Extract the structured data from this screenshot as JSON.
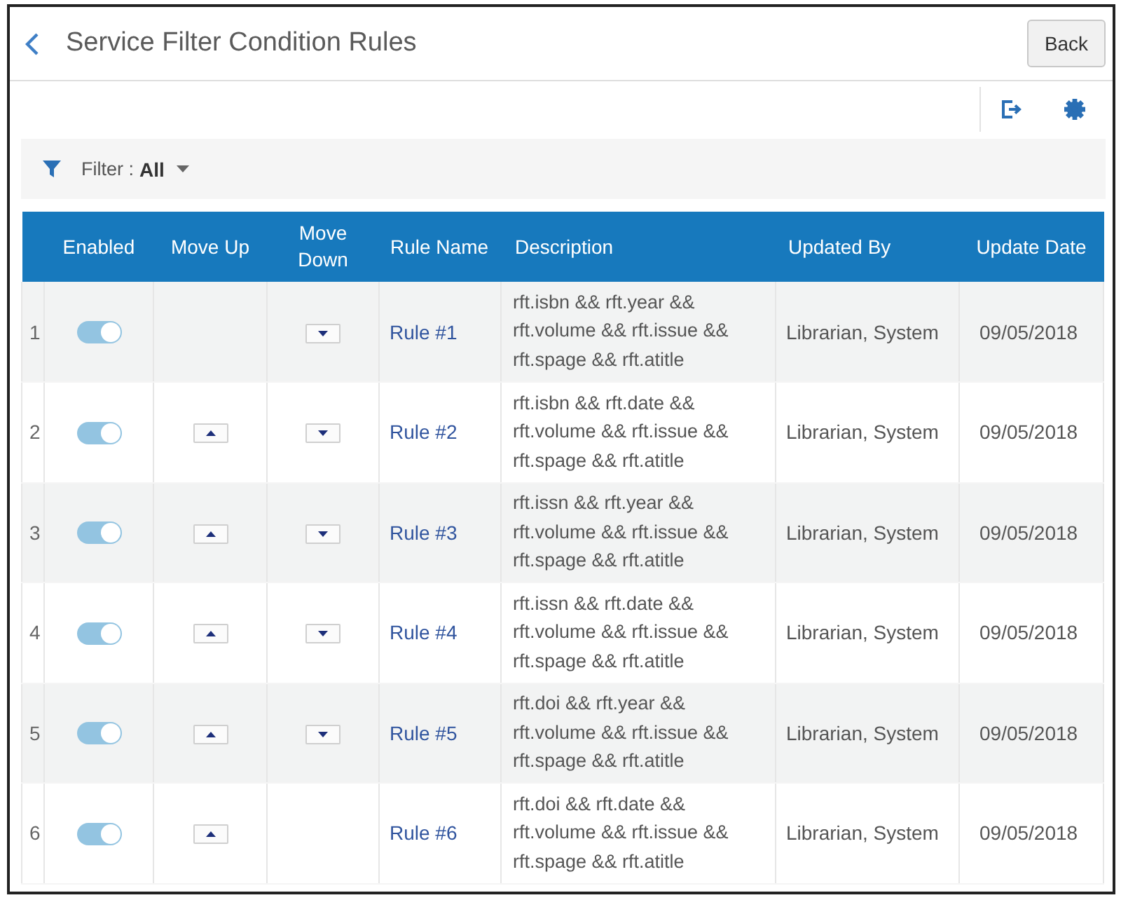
{
  "header": {
    "title": "Service Filter Condition Rules",
    "back_button": "Back"
  },
  "filter": {
    "label": "Filter :",
    "value": "All"
  },
  "table": {
    "columns": [
      "Enabled",
      "Move Up",
      "Move Down",
      "Rule Name",
      "Description",
      "Updated By",
      "Update Date"
    ],
    "rows": [
      {
        "number": "1",
        "enabled": true,
        "can_move_up": false,
        "can_move_down": true,
        "rule_name": "Rule #1",
        "description": "rft.isbn && rft.year && rft.volume && rft.issue && rft.spage && rft.atitle",
        "updated_by": "Librarian, System",
        "update_date": "09/05/2018"
      },
      {
        "number": "2",
        "enabled": true,
        "can_move_up": true,
        "can_move_down": true,
        "rule_name": "Rule #2",
        "description": "rft.isbn && rft.date && rft.volume && rft.issue && rft.spage && rft.atitle",
        "updated_by": "Librarian, System",
        "update_date": "09/05/2018"
      },
      {
        "number": "3",
        "enabled": true,
        "can_move_up": true,
        "can_move_down": true,
        "rule_name": "Rule #3",
        "description": "rft.issn && rft.year && rft.volume && rft.issue && rft.spage && rft.atitle",
        "updated_by": "Librarian, System",
        "update_date": "09/05/2018"
      },
      {
        "number": "4",
        "enabled": true,
        "can_move_up": true,
        "can_move_down": true,
        "rule_name": "Rule #4",
        "description": "rft.issn && rft.date && rft.volume && rft.issue && rft.spage && rft.atitle",
        "updated_by": "Librarian, System",
        "update_date": "09/05/2018"
      },
      {
        "number": "5",
        "enabled": true,
        "can_move_up": true,
        "can_move_down": true,
        "rule_name": "Rule #5",
        "description": "rft.doi && rft.year && rft.volume && rft.issue && rft.spage && rft.atitle",
        "updated_by": "Librarian, System",
        "update_date": "09/05/2018"
      },
      {
        "number": "6",
        "enabled": true,
        "can_move_up": true,
        "can_move_down": false,
        "rule_name": "Rule #6",
        "description": "rft.doi && rft.date && rft.volume && rft.issue && rft.spage && rft.atitle",
        "updated_by": "Librarian, System",
        "update_date": "09/05/2018"
      }
    ]
  }
}
